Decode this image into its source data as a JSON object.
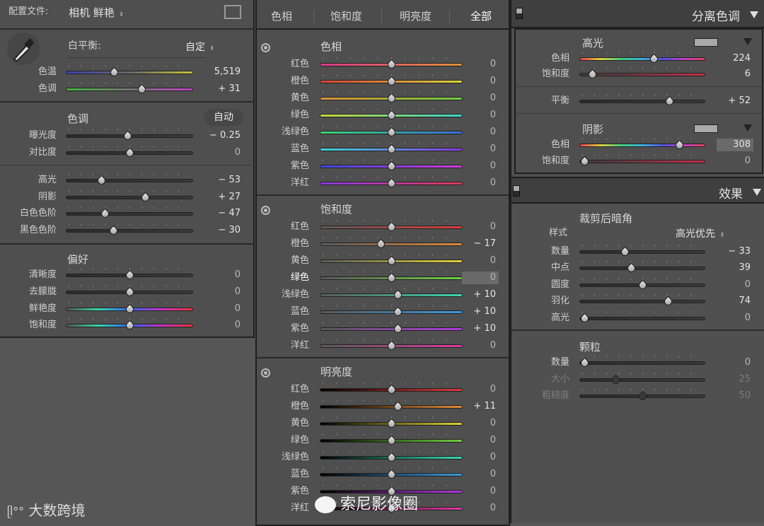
{
  "left": {
    "profile_label": "配置文件:",
    "profile_value": "相机 鲜艳",
    "wb_label": "白平衡:",
    "wb_value": "自定",
    "wb_sliders": [
      {
        "label": "色温",
        "value": "5,519",
        "pos": 0.37,
        "track": "temp"
      },
      {
        "label": "色调",
        "value": "+ 31",
        "pos": 0.6,
        "track": "tint"
      }
    ],
    "tone_title": "色调",
    "auto_button": "自动",
    "tone_sliders": [
      {
        "label": "曝光度",
        "value": "− 0.25",
        "pos": 0.48,
        "track": "gray"
      },
      {
        "label": "对比度",
        "value": "0",
        "pos": 0.5,
        "track": "gray"
      }
    ],
    "tone2_sliders": [
      {
        "label": "高光",
        "value": "− 53",
        "pos": 0.26,
        "track": "gray"
      },
      {
        "label": "阴影",
        "value": "+ 27",
        "pos": 0.63,
        "track": "gray"
      },
      {
        "label": "白色色阶",
        "value": "− 47",
        "pos": 0.29,
        "track": "gray"
      },
      {
        "label": "黑色色阶",
        "value": "− 30",
        "pos": 0.36,
        "track": "gray"
      }
    ],
    "presence_title": "偏好",
    "presence_sliders": [
      {
        "label": "清晰度",
        "value": "0",
        "pos": 0.5,
        "track": "gray"
      },
      {
        "label": "去朦胧",
        "value": "0",
        "pos": 0.5,
        "track": "gray"
      },
      {
        "label": "鲜艳度",
        "value": "0",
        "pos": 0.5,
        "track": "vib"
      },
      {
        "label": "饱和度",
        "value": "0",
        "pos": 0.5,
        "track": "vib"
      }
    ]
  },
  "hsl": {
    "tabs": [
      "色相",
      "饱和度",
      "明亮度",
      "全部"
    ],
    "active_tab": 3,
    "sections": [
      {
        "title": "色相",
        "mode": "hue",
        "rows": [
          {
            "label": "红色",
            "value": "0",
            "pos": 0.5
          },
          {
            "label": "橙色",
            "value": "0",
            "pos": 0.5
          },
          {
            "label": "黄色",
            "value": "0",
            "pos": 0.5
          },
          {
            "label": "绿色",
            "value": "0",
            "pos": 0.5
          },
          {
            "label": "浅绿色",
            "value": "0",
            "pos": 0.5
          },
          {
            "label": "蓝色",
            "value": "0",
            "pos": 0.5
          },
          {
            "label": "紫色",
            "value": "0",
            "pos": 0.5
          },
          {
            "label": "洋红",
            "value": "0",
            "pos": 0.5
          }
        ]
      },
      {
        "title": "饱和度",
        "mode": "sat",
        "rows": [
          {
            "label": "红色",
            "value": "0",
            "pos": 0.5
          },
          {
            "label": "橙色",
            "value": "− 17",
            "pos": 0.42
          },
          {
            "label": "黄色",
            "value": "0",
            "pos": 0.5
          },
          {
            "label": "绿色",
            "value": "0",
            "pos": 0.5,
            "selected": true
          },
          {
            "label": "浅绿色",
            "value": "+ 10",
            "pos": 0.55
          },
          {
            "label": "蓝色",
            "value": "+ 10",
            "pos": 0.55
          },
          {
            "label": "紫色",
            "value": "+ 10",
            "pos": 0.55
          },
          {
            "label": "洋红",
            "value": "0",
            "pos": 0.5
          }
        ]
      },
      {
        "title": "明亮度",
        "mode": "lum",
        "rows": [
          {
            "label": "红色",
            "value": "0",
            "pos": 0.5
          },
          {
            "label": "橙色",
            "value": "+ 11",
            "pos": 0.55
          },
          {
            "label": "黄色",
            "value": "0",
            "pos": 0.5
          },
          {
            "label": "绿色",
            "value": "0",
            "pos": 0.5
          },
          {
            "label": "浅绿色",
            "value": "0",
            "pos": 0.5
          },
          {
            "label": "蓝色",
            "value": "0",
            "pos": 0.5
          },
          {
            "label": "紫色",
            "value": "0",
            "pos": 0.5
          },
          {
            "label": "洋红",
            "value": "0",
            "pos": 0.5
          }
        ]
      }
    ]
  },
  "split": {
    "header": "分离色调",
    "highlights_title": "高光",
    "highlights": [
      {
        "label": "色相",
        "value": "224",
        "pos": 0.6,
        "track": "hue"
      },
      {
        "label": "饱和度",
        "value": "6",
        "pos": 0.07,
        "track": "satred"
      }
    ],
    "balance": {
      "label": "平衡",
      "value": "+ 52",
      "pos": 0.73,
      "track": "gray"
    },
    "shadows_title": "阴影",
    "shadows": [
      {
        "label": "色相",
        "value": "308",
        "pos": 0.82,
        "track": "hue",
        "highlight": true
      },
      {
        "label": "饱和度",
        "value": "0",
        "pos": 0.0,
        "track": "satred"
      }
    ]
  },
  "effects": {
    "header": "效果",
    "vignette_title": "裁剪后暗角",
    "style_label": "样式",
    "style_value": "高光优先",
    "vignette": [
      {
        "label": "数量",
        "value": "− 33",
        "pos": 0.35,
        "track": "gray"
      },
      {
        "label": "中点",
        "value": "39",
        "pos": 0.4,
        "track": "gray"
      },
      {
        "label": "圆度",
        "value": "0",
        "pos": 0.5,
        "track": "gray"
      },
      {
        "label": "羽化",
        "value": "74",
        "pos": 0.72,
        "track": "gray"
      },
      {
        "label": "高光",
        "value": "0",
        "pos": 0.0,
        "track": "gray"
      }
    ],
    "grain_title": "颗粒",
    "grain": [
      {
        "label": "数量",
        "value": "0",
        "pos": 0.0,
        "track": "gray"
      },
      {
        "label": "大小",
        "value": "25",
        "pos": 0.27,
        "track": "gray",
        "disabled": true
      },
      {
        "label": "粗糙度",
        "value": "50",
        "pos": 0.5,
        "track": "gray",
        "disabled": true
      }
    ]
  },
  "watermarks": [
    "大数跨境",
    "索尼影像圈"
  ]
}
